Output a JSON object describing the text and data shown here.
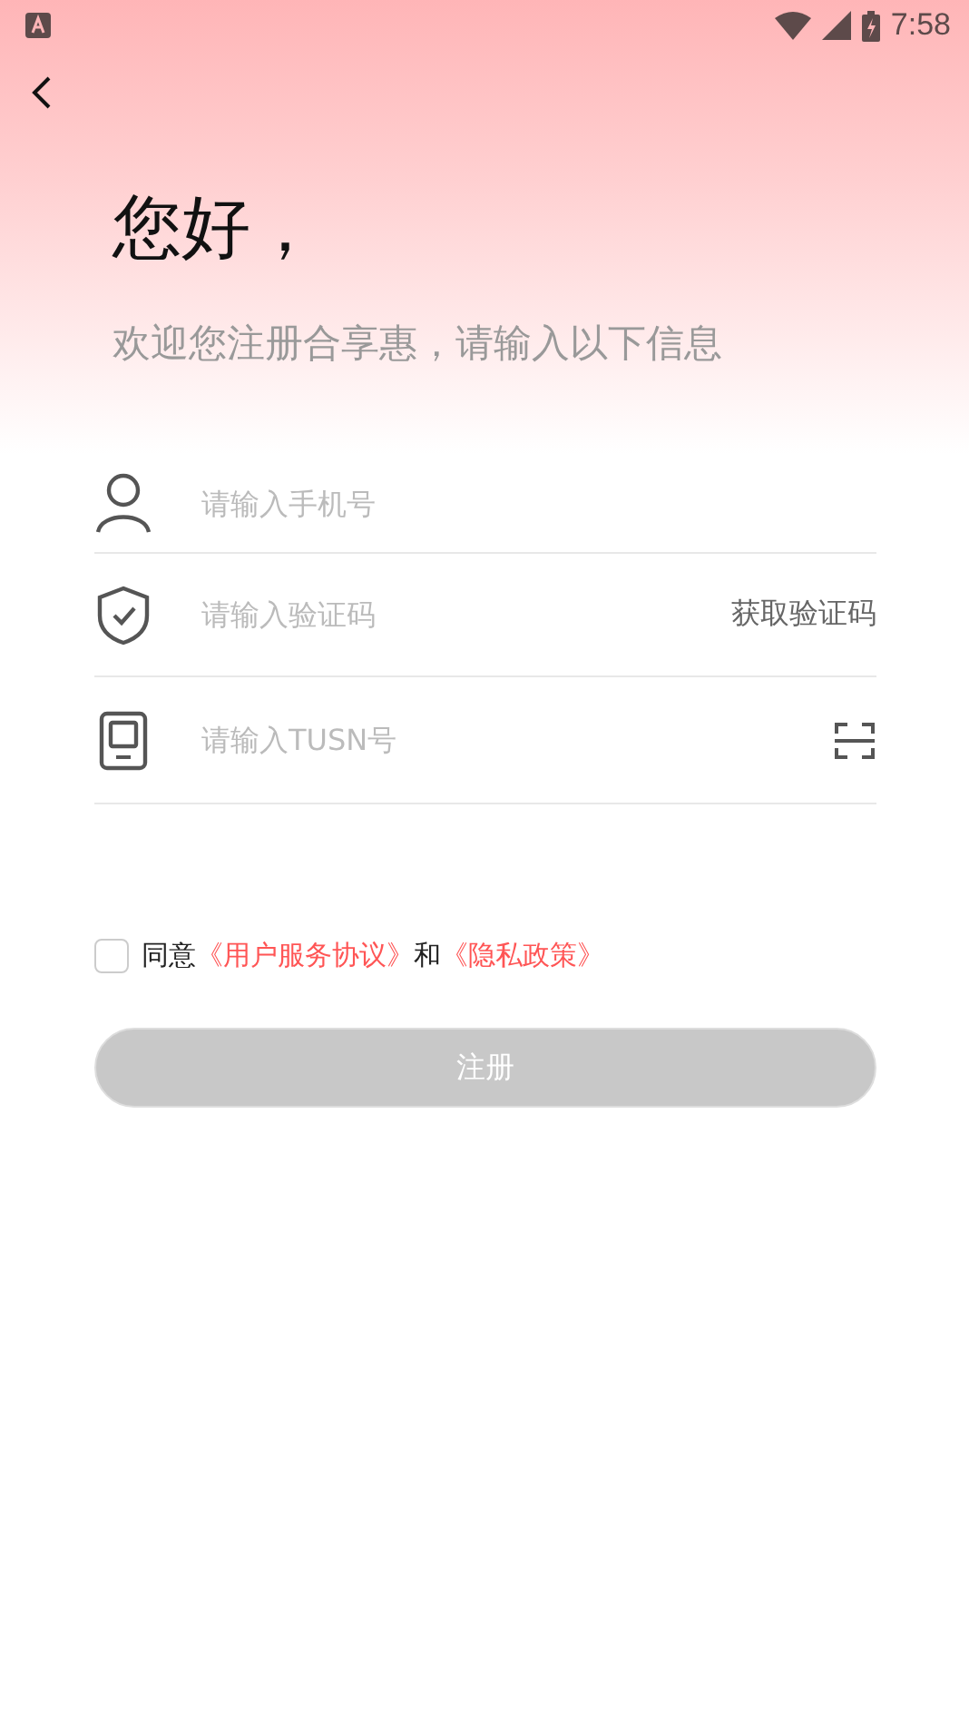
{
  "status_bar": {
    "time": "7:58"
  },
  "greeting": {
    "title": "您好，",
    "subtitle": "欢迎您注册合享惠，请输入以下信息"
  },
  "fields": [
    {
      "kind": "phone",
      "placeholder": "请输入手机号"
    },
    {
      "kind": "code",
      "placeholder": "请输入验证码",
      "action": "获取验证码"
    },
    {
      "kind": "tusn",
      "placeholder": "请输入TUSN号"
    }
  ],
  "agreement": {
    "checked": false,
    "prefix": "同意",
    "link_1": "《用户服务协议》",
    "middle": "和",
    "link_2": "《隐私政策》"
  },
  "register_button": {
    "label": "注册",
    "disabled": true
  }
}
